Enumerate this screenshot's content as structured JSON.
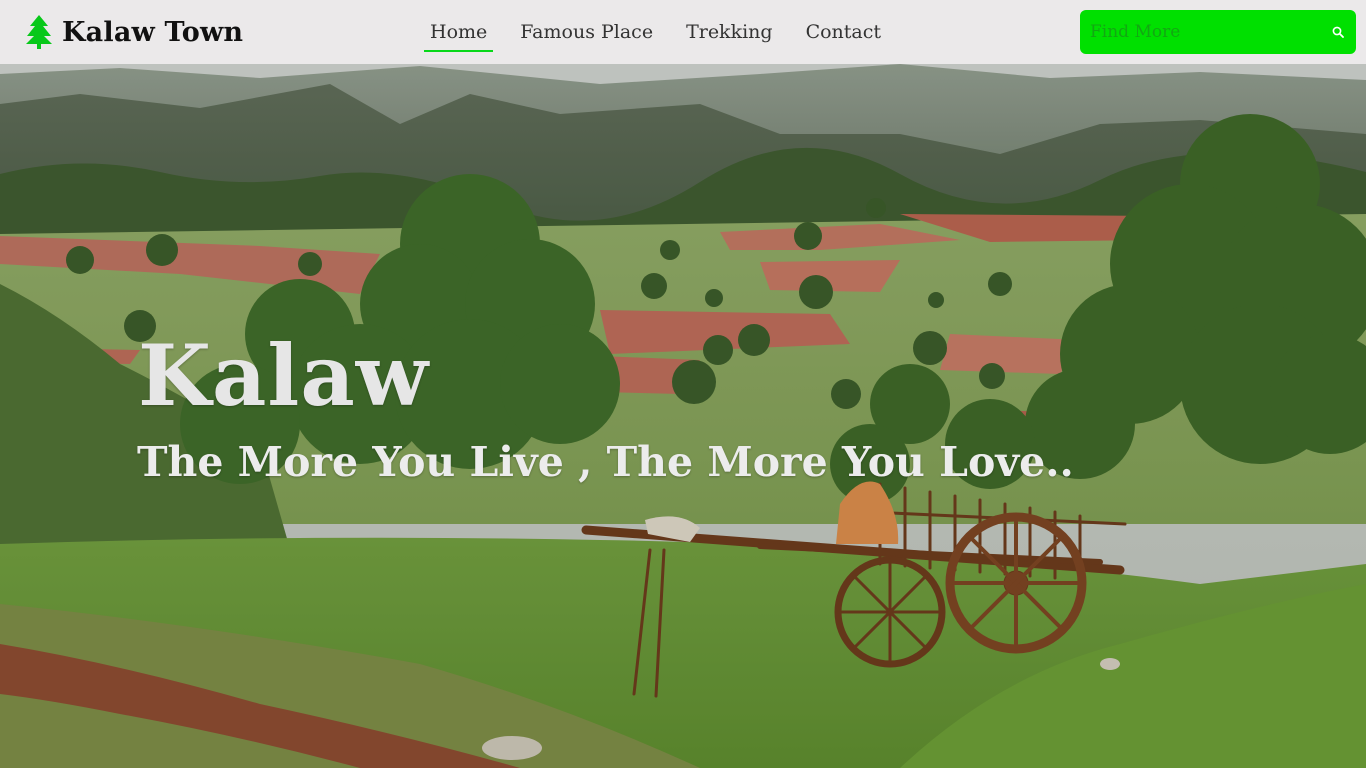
{
  "brand": {
    "name": "Kalaw Town",
    "icon": "tree-icon",
    "icon_color": "#08c81a"
  },
  "nav": {
    "items": [
      {
        "label": "Home",
        "active": true
      },
      {
        "label": "Famous Place",
        "active": false
      },
      {
        "label": "Trekking",
        "active": false
      },
      {
        "label": "Contact",
        "active": false
      }
    ],
    "active_underline_color": "#08d81a"
  },
  "search": {
    "placeholder": "Find More",
    "value": "",
    "icon": "search-icon",
    "background": "#00e000"
  },
  "hero": {
    "title": "Kalaw",
    "tagline": "The More You Live , The More You Love..",
    "image": "mountain-valley-with-ox-cart"
  }
}
